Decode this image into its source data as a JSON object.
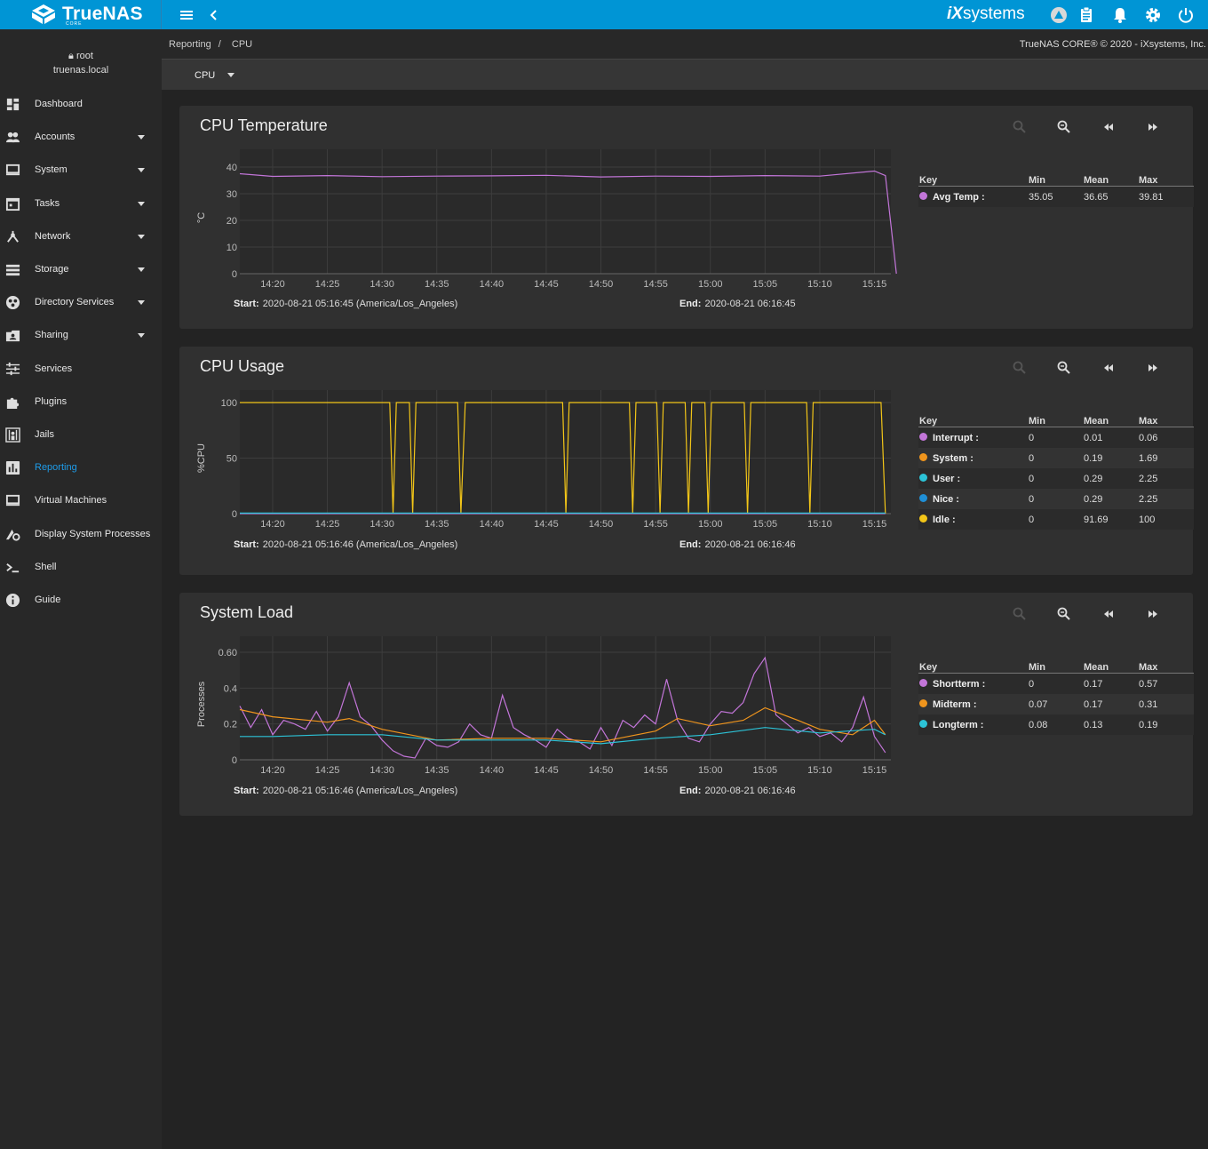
{
  "topbar": {
    "brand": "TrueNAS",
    "brand_sub": "CORE",
    "vendor_logo_ix": "iX",
    "vendor_logo_systems": "systems",
    "icons": [
      "menu-icon",
      "chevron-left-icon",
      "truecommand-icon",
      "clipboard-icon",
      "bell-icon",
      "gear-icon",
      "power-icon"
    ]
  },
  "user": {
    "name": "root",
    "host": "truenas.local"
  },
  "sidebar": {
    "items": [
      {
        "label": "Dashboard",
        "icon": "dashboard-icon",
        "caret": false
      },
      {
        "label": "Accounts",
        "icon": "accounts-icon",
        "caret": true
      },
      {
        "label": "System",
        "icon": "monitor-icon",
        "caret": true
      },
      {
        "label": "Tasks",
        "icon": "calendar-icon",
        "caret": true
      },
      {
        "label": "Network",
        "icon": "network-icon",
        "caret": true
      },
      {
        "label": "Storage",
        "icon": "storage-icon",
        "caret": true
      },
      {
        "label": "Directory Services",
        "icon": "directory-icon",
        "caret": true
      },
      {
        "label": "Sharing",
        "icon": "sharing-icon",
        "caret": true
      },
      {
        "label": "Services",
        "icon": "tune-icon",
        "caret": false
      },
      {
        "label": "Plugins",
        "icon": "puzzle-icon",
        "caret": false
      },
      {
        "label": "Jails",
        "icon": "jail-icon",
        "caret": false
      },
      {
        "label": "Reporting",
        "icon": "chart-icon",
        "caret": false,
        "active": true
      },
      {
        "label": "Virtual Machines",
        "icon": "vm-icon",
        "caret": false
      },
      {
        "label": "Display System Processes",
        "icon": "processes-icon",
        "caret": false
      },
      {
        "label": "Shell",
        "icon": "shell-icon",
        "caret": false
      },
      {
        "label": "Guide",
        "icon": "info-icon",
        "caret": false
      }
    ]
  },
  "breadcrumb": {
    "parent": "Reporting",
    "sep": "/",
    "current": "CPU"
  },
  "copyright": "TrueNAS CORE® © 2020 - iXsystems, Inc.",
  "selector": {
    "value": "CPU"
  },
  "ui": {
    "start_label": "Start:",
    "end_label": "End:",
    "key": "Key",
    "min": "Min",
    "mean": "Mean",
    "max": "Max"
  },
  "colors": {
    "topbar": "#0095d5",
    "active": "#1e9be8",
    "purple": "#c275d8",
    "orange": "#f0951d",
    "cyan": "#2cc3d7",
    "blue": "#1f8fd6",
    "yellow": "#f2c518"
  },
  "cards": [
    {
      "title": "CPU Temperature",
      "start": "2020-08-21 05:16:45 (America/Los_Angeles)",
      "end": "2020-08-21 06:16:45",
      "legend": [
        {
          "name": "Avg Temp :",
          "color": "#c275d8",
          "min": "35.05",
          "mean": "36.65",
          "max": "39.81"
        }
      ]
    },
    {
      "title": "CPU Usage",
      "start": "2020-08-21 05:16:46 (America/Los_Angeles)",
      "end": "2020-08-21 06:16:46",
      "legend": [
        {
          "name": "Interrupt :",
          "color": "#c275d8",
          "min": "0",
          "mean": "0.01",
          "max": "0.06"
        },
        {
          "name": "System :",
          "color": "#f0951d",
          "min": "0",
          "mean": "0.19",
          "max": "1.69"
        },
        {
          "name": "User :",
          "color": "#2cc3d7",
          "min": "0",
          "mean": "0.29",
          "max": "2.25"
        },
        {
          "name": "Nice :",
          "color": "#1f8fd6",
          "min": "0",
          "mean": "0.29",
          "max": "2.25"
        },
        {
          "name": "Idle :",
          "color": "#f2c518",
          "min": "0",
          "mean": "91.69",
          "max": "100"
        }
      ]
    },
    {
      "title": "System Load",
      "start": "2020-08-21 05:16:46 (America/Los_Angeles)",
      "end": "2020-08-21 06:16:46",
      "legend": [
        {
          "name": "Shortterm :",
          "color": "#c275d8",
          "min": "0",
          "mean": "0.17",
          "max": "0.57"
        },
        {
          "name": "Midterm :",
          "color": "#f0951d",
          "min": "0.07",
          "mean": "0.17",
          "max": "0.31"
        },
        {
          "name": "Longterm :",
          "color": "#2cc3d7",
          "min": "0.08",
          "mean": "0.13",
          "max": "0.19"
        }
      ]
    }
  ],
  "chart_data": [
    {
      "type": "line",
      "title": "CPU Temperature",
      "ylabel": "°C",
      "xticks": [
        "14:20",
        "14:25",
        "14:30",
        "14:35",
        "14:40",
        "14:45",
        "14:50",
        "14:55",
        "15:00",
        "15:05",
        "15:10",
        "15:15"
      ],
      "yticks": [
        "0",
        "10",
        "20",
        "30",
        "40"
      ],
      "ylim": [
        0,
        42
      ],
      "series": [
        {
          "name": "Avg Temp",
          "color": "#c275d8",
          "x": [
            "14:17",
            "14:20",
            "14:25",
            "14:30",
            "14:35",
            "14:40",
            "14:45",
            "14:50",
            "14:55",
            "15:00",
            "15:05",
            "15:10",
            "15:15",
            "15:16",
            "15:17"
          ],
          "values": [
            37.5,
            36.5,
            36.8,
            36.4,
            36.6,
            36.7,
            36.9,
            36.3,
            36.6,
            36.5,
            36.8,
            36.6,
            38.5,
            36.8,
            0
          ]
        }
      ]
    },
    {
      "type": "line",
      "title": "CPU Usage",
      "ylabel": "%CPU",
      "xticks": [
        "14:20",
        "14:25",
        "14:30",
        "14:35",
        "14:40",
        "14:45",
        "14:50",
        "14:55",
        "15:00",
        "15:05",
        "15:10",
        "15:15"
      ],
      "yticks": [
        "0",
        "50",
        "100"
      ],
      "ylim": [
        0,
        100
      ],
      "series": [
        {
          "name": "Idle",
          "color": "#f2c518",
          "x": [
            "14:17",
            "14:30.7",
            "14:31",
            "14:31.3",
            "14:32.5",
            "14:32.8",
            "14:33.1",
            "14:36.9",
            "14:37.2",
            "14:37.6",
            "14:46.5",
            "14:46.8",
            "14:47.1",
            "14:52.6",
            "14:52.9",
            "14:53.2",
            "14:55.1",
            "14:55.4",
            "14:55.7",
            "14:57.7",
            "14:58",
            "14:58.3",
            "14:59.5",
            "14:59.8",
            "15:00.1",
            "15:03.1",
            "15:03.4",
            "15:03.7",
            "15:08.8",
            "15:09.1",
            "15:09.4",
            "15:15.6",
            "15:16"
          ],
          "values": [
            100,
            100,
            0,
            100,
            100,
            0,
            100,
            100,
            0,
            100,
            100,
            0,
            100,
            100,
            0,
            100,
            100,
            0,
            100,
            100,
            0,
            100,
            100,
            0,
            100,
            100,
            0,
            100,
            100,
            0,
            100,
            100,
            0
          ]
        },
        {
          "name": "Interrupt",
          "color": "#c275d8",
          "x": [
            "14:17",
            "15:16"
          ],
          "values": [
            0,
            0
          ]
        },
        {
          "name": "User",
          "color": "#2cc3d7",
          "x": [
            "14:17",
            "15:16"
          ],
          "values": [
            0.5,
            0.5
          ]
        }
      ]
    },
    {
      "type": "line",
      "title": "System Load",
      "ylabel": "Processes",
      "xticks": [
        "14:20",
        "14:25",
        "14:30",
        "14:35",
        "14:40",
        "14:45",
        "14:50",
        "14:55",
        "15:00",
        "15:05",
        "15:10",
        "15:15"
      ],
      "yticks": [
        "0",
        "0.2",
        "0.4",
        "0.60"
      ],
      "ylim": [
        0,
        0.62
      ],
      "series": [
        {
          "name": "Shortterm",
          "color": "#c275d8",
          "x": [
            "14:17",
            "14:18",
            "14:19",
            "14:20",
            "14:21",
            "14:22",
            "14:23",
            "14:24",
            "14:25",
            "14:26",
            "14:27",
            "14:28",
            "14:29",
            "14:30",
            "14:31",
            "14:32",
            "14:33",
            "14:34",
            "14:35",
            "14:36",
            "14:37",
            "14:38",
            "14:39",
            "14:40",
            "14:41",
            "14:42",
            "14:43",
            "14:44",
            "14:45",
            "14:46",
            "14:47",
            "14:48",
            "14:49",
            "14:50",
            "14:51",
            "14:52",
            "14:53",
            "14:54",
            "14:55",
            "14:56",
            "14:57",
            "14:58",
            "14:59",
            "15:00",
            "15:01",
            "15:02",
            "15:03",
            "15:04",
            "15:05",
            "15:06",
            "15:07",
            "15:08",
            "15:09",
            "15:10",
            "15:11",
            "15:12",
            "15:13",
            "15:14",
            "15:15",
            "15:16"
          ],
          "values": [
            0.3,
            0.18,
            0.28,
            0.14,
            0.22,
            0.2,
            0.17,
            0.27,
            0.16,
            0.24,
            0.43,
            0.24,
            0.19,
            0.11,
            0.05,
            0.02,
            0.01,
            0.12,
            0.08,
            0.07,
            0.1,
            0.2,
            0.14,
            0.12,
            0.36,
            0.18,
            0.14,
            0.11,
            0.07,
            0.17,
            0.12,
            0.1,
            0.06,
            0.18,
            0.08,
            0.22,
            0.18,
            0.25,
            0.2,
            0.45,
            0.22,
            0.12,
            0.1,
            0.2,
            0.27,
            0.26,
            0.32,
            0.48,
            0.57,
            0.25,
            0.2,
            0.15,
            0.18,
            0.13,
            0.15,
            0.1,
            0.18,
            0.35,
            0.13,
            0.04
          ]
        },
        {
          "name": "Midterm",
          "color": "#f0951d",
          "x": [
            "14:17",
            "14:20",
            "14:25",
            "14:27",
            "14:30",
            "14:35",
            "14:40",
            "14:45",
            "14:50",
            "14:55",
            "14:57",
            "15:00",
            "15:03",
            "15:05",
            "15:08",
            "15:10",
            "15:13",
            "15:15",
            "15:16"
          ],
          "values": [
            0.28,
            0.24,
            0.21,
            0.23,
            0.17,
            0.11,
            0.12,
            0.12,
            0.1,
            0.16,
            0.23,
            0.19,
            0.22,
            0.29,
            0.22,
            0.17,
            0.14,
            0.22,
            0.14
          ]
        },
        {
          "name": "Longterm",
          "color": "#2cc3d7",
          "x": [
            "14:17",
            "14:20",
            "14:25",
            "14:30",
            "14:35",
            "14:40",
            "14:45",
            "14:50",
            "14:55",
            "15:00",
            "15:05",
            "15:10",
            "15:15",
            "15:16"
          ],
          "values": [
            0.13,
            0.13,
            0.14,
            0.14,
            0.11,
            0.11,
            0.11,
            0.09,
            0.12,
            0.14,
            0.18,
            0.15,
            0.17,
            0.14
          ]
        }
      ]
    }
  ]
}
